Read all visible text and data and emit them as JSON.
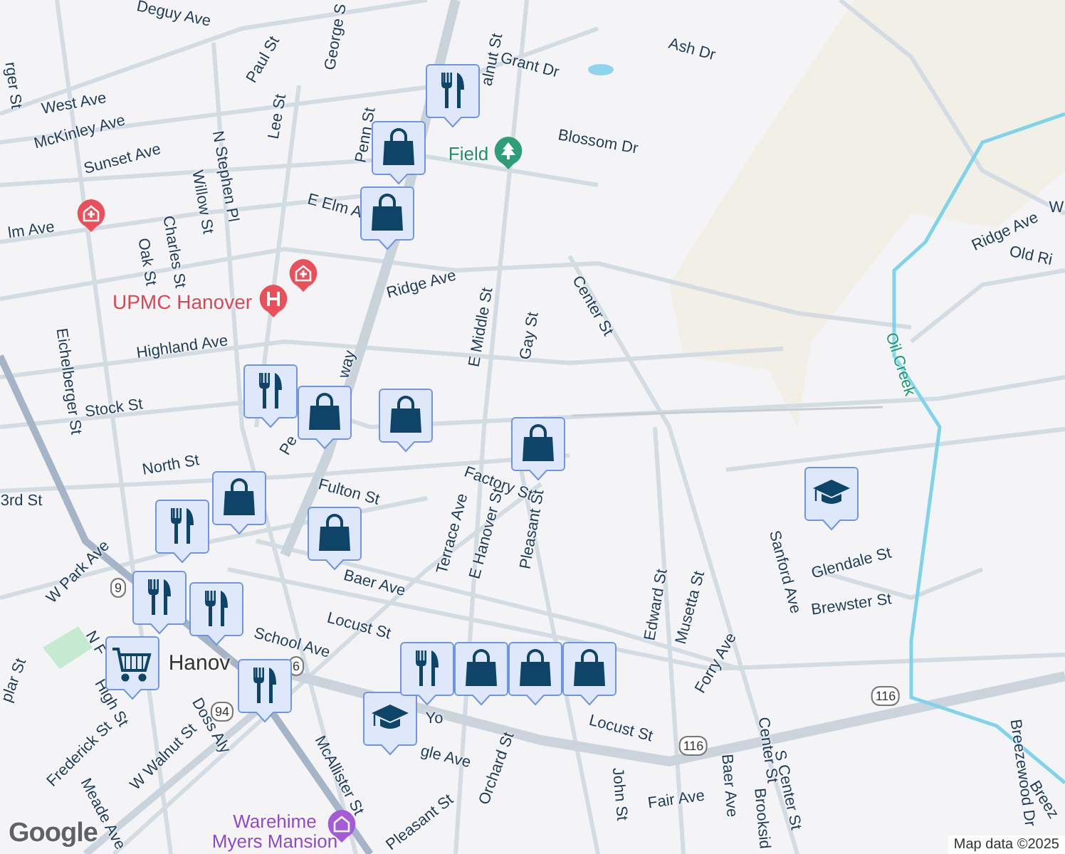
{
  "streets": [
    "Deguy Ave",
    "Grant Dr",
    "Ash Dr",
    "Blossom Dr",
    "West Ave",
    "McKinley Ave",
    "Sunset Ave",
    "Paul St",
    "George S",
    "Lee St",
    "Penn St",
    "alnut St",
    "N Stephen Pl",
    "Willow St",
    "Charles St",
    "Oak St",
    "E Elm A",
    "lm Ave",
    "Ridge Ave",
    "E Middle St",
    "Gay St",
    "Center St",
    "Highland Ave",
    "Stock St",
    "Eichelberger St",
    "rger St",
    "Pe",
    "way",
    "North St",
    "3rd St",
    "Fulton St",
    "Factory St",
    "Terrace Ave",
    "E Hanover St",
    "Pleasant St",
    "Baer Ave",
    "Locust St",
    "School Ave",
    "W Park Ave",
    "N F",
    "High St",
    "plar St",
    "Frederick St",
    "Doss Aly",
    "W Walnut St",
    "Meade Ave",
    "McAllister St",
    "gle Ave",
    "Yo",
    "Orchard St",
    "Pleasant St",
    "John St",
    "Fair Ave",
    "Baer Ave",
    "Brooksid",
    "S Center St",
    "Locust St",
    "Center St",
    "Edward St",
    "Musetta St",
    "Forry Ave",
    "Sanford Ave",
    "Glendale St",
    "Brewster St",
    "Breezewood Dr",
    "Breez",
    "Ridge Ave",
    "Old Ri",
    "W"
  ],
  "places": [
    {
      "name": "UPMC Hanover",
      "kind": "hospital"
    },
    {
      "name": "Warehime Myers Mansion",
      "kind": "museum"
    },
    {
      "name": "Field",
      "kind": "park"
    },
    {
      "name": "Hanov",
      "kind": "town"
    }
  ],
  "waterway": "Oil Creek",
  "pois": [
    {
      "kind": "hospital"
    },
    {
      "kind": "hospital"
    }
  ],
  "route_shields": [
    "9",
    "6",
    "94",
    "116",
    "116"
  ],
  "pins": [
    {
      "kind": "restaurant"
    },
    {
      "kind": "shopping"
    },
    {
      "kind": "shopping"
    },
    {
      "kind": "restaurant"
    },
    {
      "kind": "shopping"
    },
    {
      "kind": "shopping"
    },
    {
      "kind": "shopping"
    },
    {
      "kind": "shopping"
    },
    {
      "kind": "restaurant"
    },
    {
      "kind": "restaurant"
    },
    {
      "kind": "restaurant"
    },
    {
      "kind": "restaurant"
    },
    {
      "kind": "shopping"
    },
    {
      "kind": "grocery"
    },
    {
      "kind": "school"
    },
    {
      "kind": "school"
    },
    {
      "kind": "restaurant"
    },
    {
      "kind": "shopping"
    },
    {
      "kind": "shopping"
    },
    {
      "kind": "shopping"
    }
  ],
  "attribution": "Map data ©2025",
  "logo": "Google"
}
